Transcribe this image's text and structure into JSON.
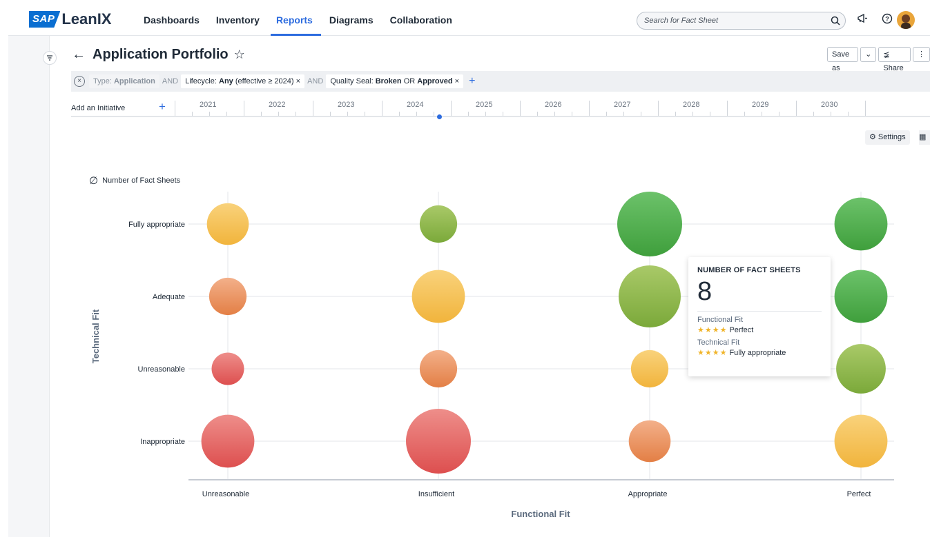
{
  "app": {
    "brand_sap": "SAP",
    "brand_name": "LeanIX"
  },
  "nav": {
    "items": [
      "Dashboards",
      "Inventory",
      "Reports",
      "Diagrams",
      "Collaboration"
    ],
    "active": "Reports"
  },
  "search": {
    "placeholder": "Search for Fact Sheet"
  },
  "page": {
    "title": "Application Portfolio",
    "save_as": "Save as",
    "share": "Share"
  },
  "filters": {
    "type_label": "Type: ",
    "type_value": "Application",
    "and1": "AND",
    "lifecycle_label": "Lifecycle: ",
    "lifecycle_value": "Any",
    "lifecycle_suffix": " (effective ≥ 2024)",
    "and2": "AND",
    "seal_label": "Quality Seal: ",
    "seal_value1": "Broken",
    "seal_or": " OR ",
    "seal_value2": "Approved",
    "remove": "×"
  },
  "timeline": {
    "add_label": "Add an Initiative",
    "years": [
      "2021",
      "2022",
      "2023",
      "2024",
      "2025",
      "2026",
      "2027",
      "2028",
      "2029",
      "2030"
    ]
  },
  "toolbar": {
    "settings": "Settings"
  },
  "legend": {
    "label": "Number of Fact Sheets"
  },
  "tooltip": {
    "heading": "NUMBER OF FACT SHEETS",
    "value": "8",
    "func_label": "Functional Fit",
    "func_stars": "★★★★",
    "func_value": "Perfect",
    "tech_label": "Technical Fit",
    "tech_stars": "★★★★",
    "tech_value": "Fully appropriate"
  },
  "colors": {
    "accent": "#2d6cdf",
    "red": "#e2555a",
    "orange": "#ec8f55",
    "yellow": "#f6c04b",
    "lightgreen": "#8fb84a",
    "green": "#4bab43"
  },
  "chart_data": {
    "type": "bubble",
    "xlabel": "Functional Fit",
    "ylabel": "Technical Fit",
    "x_categories": [
      "Unreasonable",
      "Insufficient",
      "Appropriate",
      "Perfect"
    ],
    "y_categories": [
      "Fully appropriate",
      "Adequate",
      "Unreasonable",
      "Inappropriate"
    ],
    "points": [
      {
        "x": "Unreasonable",
        "y": "Fully appropriate",
        "size": 5,
        "color": "yellow"
      },
      {
        "x": "Insufficient",
        "y": "Fully appropriate",
        "size": 4,
        "color": "lightgreen"
      },
      {
        "x": "Appropriate",
        "y": "Fully appropriate",
        "size": 12,
        "color": "green"
      },
      {
        "x": "Perfect",
        "y": "Fully appropriate",
        "size": 8,
        "color": "green"
      },
      {
        "x": "Unreasonable",
        "y": "Adequate",
        "size": 4,
        "color": "orange"
      },
      {
        "x": "Insufficient",
        "y": "Adequate",
        "size": 8,
        "color": "yellow"
      },
      {
        "x": "Appropriate",
        "y": "Adequate",
        "size": 11,
        "color": "lightgreen"
      },
      {
        "x": "Perfect",
        "y": "Adequate",
        "size": 8,
        "color": "green"
      },
      {
        "x": "Unreasonable",
        "y": "Unreasonable",
        "size": 3,
        "color": "red"
      },
      {
        "x": "Insufficient",
        "y": "Unreasonable",
        "size": 4,
        "color": "orange"
      },
      {
        "x": "Appropriate",
        "y": "Unreasonable",
        "size": 4,
        "color": "yellow"
      },
      {
        "x": "Perfect",
        "y": "Unreasonable",
        "size": 7,
        "color": "lightgreen"
      },
      {
        "x": "Unreasonable",
        "y": "Inappropriate",
        "size": 8,
        "color": "red"
      },
      {
        "x": "Insufficient",
        "y": "Inappropriate",
        "size": 12,
        "color": "red"
      },
      {
        "x": "Appropriate",
        "y": "Inappropriate",
        "size": 5,
        "color": "orange"
      },
      {
        "x": "Perfect",
        "y": "Inappropriate",
        "size": 8,
        "color": "yellow"
      }
    ]
  }
}
